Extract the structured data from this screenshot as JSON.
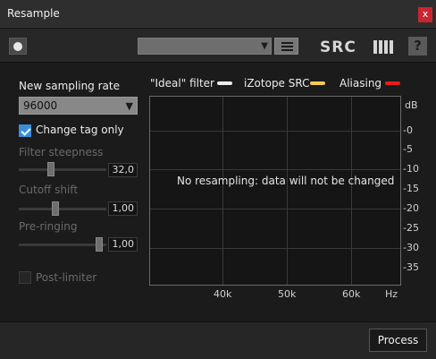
{
  "window": {
    "title": "Resample",
    "close_glyph": "x"
  },
  "toolbar": {
    "preset_value": "",
    "brand": "SRC",
    "help_glyph": "?"
  },
  "settings": {
    "sampling_rate_label": "New sampling rate",
    "sampling_rate_value": "96000",
    "change_tag_label": "Change tag only",
    "change_tag_checked": true,
    "filter_steepness_label": "Filter steepness",
    "filter_steepness_value": "32,0",
    "cutoff_shift_label": "Cutoff shift",
    "cutoff_shift_value": "1,00",
    "pre_ringing_label": "Pre-ringing",
    "pre_ringing_value": "1,00",
    "post_limiter_label": "Post-limiter",
    "post_limiter_checked": false
  },
  "legend": [
    {
      "label": "\"Ideal\" filter",
      "color": "#e8eef0"
    },
    {
      "label": "iZotope SRC",
      "color": "#f2cc55"
    },
    {
      "label": "Aliasing",
      "color": "#e81c1c"
    }
  ],
  "graph": {
    "message": "No resampling: data will not be changed",
    "db_unit": "dB",
    "db_ticks": [
      "0",
      "5",
      "10",
      "15",
      "20",
      "25",
      "30",
      "35"
    ],
    "hz_unit": "Hz",
    "hz_ticks": [
      "40k",
      "50k",
      "60k"
    ]
  },
  "footer": {
    "process_label": "Process"
  },
  "icons": {
    "record": "record-icon",
    "preset_arrow": "chevron-down-icon",
    "preset_menu": "menu-icon",
    "help": "help-icon",
    "close": "close-icon"
  }
}
